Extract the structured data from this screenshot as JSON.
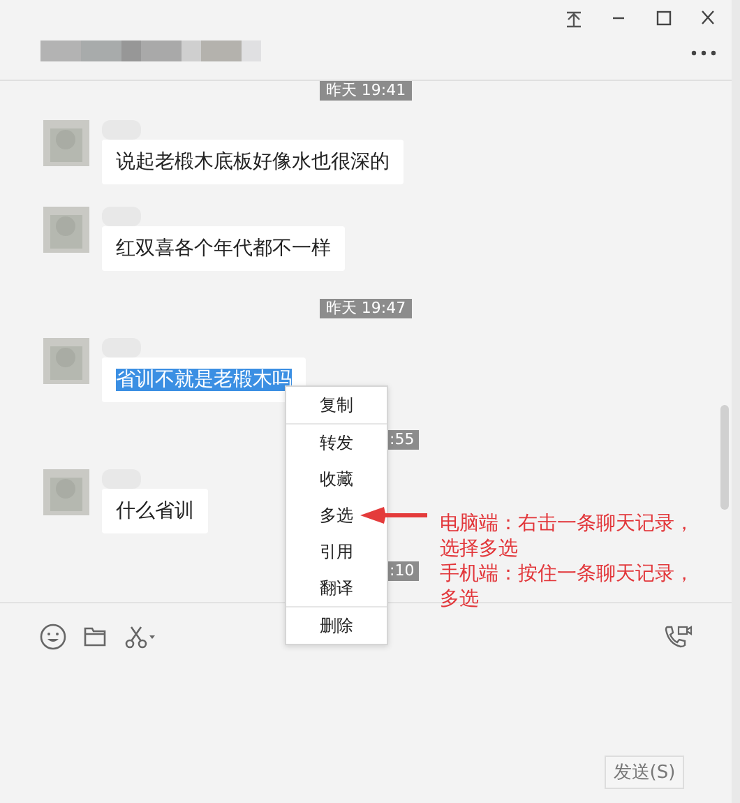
{
  "messages": [
    {
      "kind": "timestamp",
      "text": "昨天 19:41"
    },
    {
      "kind": "message",
      "text": "说起老椴木底板好像水也很深的",
      "selected": false
    },
    {
      "kind": "message",
      "text": "红双喜各个年代都不一样",
      "selected": false
    },
    {
      "kind": "timestamp",
      "text": "昨天 19:47"
    },
    {
      "kind": "message",
      "text": "省训不就是老椴木吗",
      "selected": true
    },
    {
      "kind": "timestamp_partial",
      "text": ":55"
    },
    {
      "kind": "message",
      "text": "什么省训",
      "selected": false
    },
    {
      "kind": "timestamp_partial",
      "text": ":10"
    }
  ],
  "context_menu": {
    "groups": [
      [
        {
          "label": "复制"
        }
      ],
      [
        {
          "label": "转发"
        },
        {
          "label": "收藏"
        },
        {
          "label": "多选"
        },
        {
          "label": "引用"
        },
        {
          "label": "翻译"
        }
      ],
      [
        {
          "label": "删除"
        }
      ]
    ]
  },
  "annotation": [
    "电脑端：右击一条聊天记录，选择多选",
    "手机端：按住一条聊天记录，多选"
  ],
  "send_button": "发送(S)"
}
